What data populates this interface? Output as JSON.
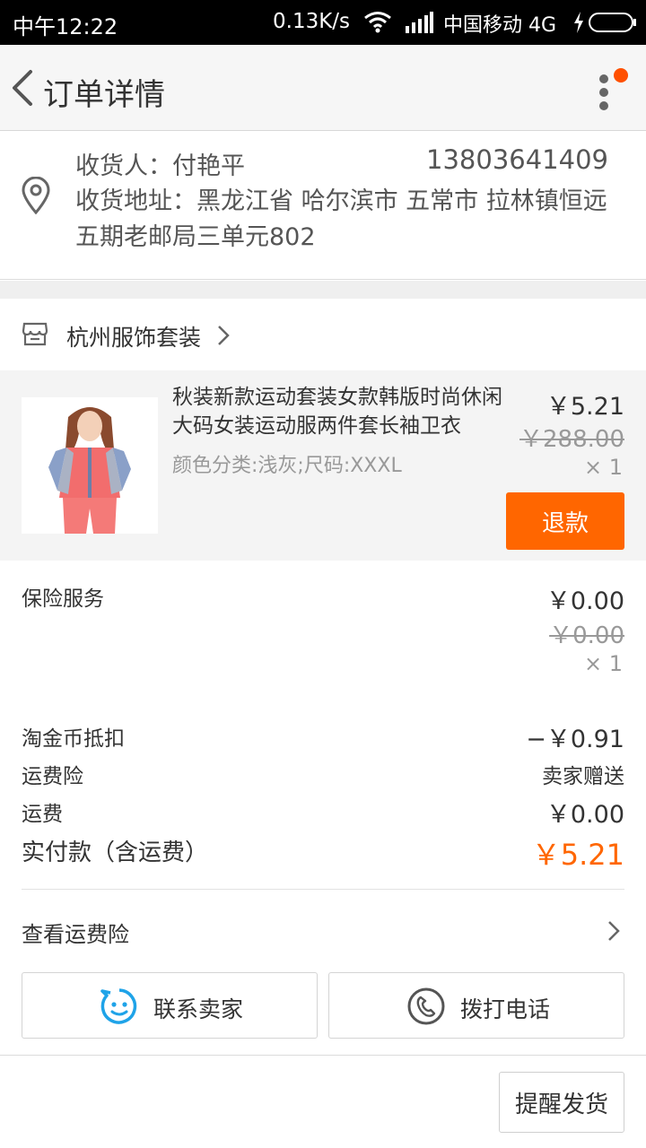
{
  "status_bar": {
    "time": "中午12:22",
    "net_speed": "0.13K/s",
    "carrier": "中国移动 4G",
    "icons": [
      "wifi-icon",
      "signal-icon",
      "charging-icon",
      "battery-icon"
    ]
  },
  "navbar": {
    "title": "订单详情",
    "back_icon": "chevron-left-icon",
    "more_icon": "more-vertical-icon",
    "badge_color": "#ff5000"
  },
  "address": {
    "receiver": "收货人：付艳平",
    "phone": "13803641409",
    "address": "收货地址：黑龙江省 哈尔滨市 五常市 拉林镇恒远五期老邮局三单元802",
    "icon": "location-pin-icon"
  },
  "shop": {
    "name": "杭州服饰套装",
    "icon": "store-icon"
  },
  "product": {
    "title": "秋装新款运动套装女款韩版时尚休闲大码女装运动服两件套长袖卫衣",
    "spec": "颜色分类:浅灰;尺码:XXXL",
    "price": "￥5.21",
    "original_price": "￥288.00",
    "quantity": "× 1",
    "refund_label": "退款"
  },
  "insurance": {
    "label": "保险服务",
    "price": "￥0.00",
    "original_price": "￥0.00",
    "quantity": "× 1"
  },
  "summary": {
    "coin_label": "淘金币抵扣",
    "coin_value": "−￥0.91",
    "freight_ins_label": "运费险",
    "freight_ins_value": "卖家赠送",
    "freight_label": "运费",
    "freight_value": "￥0.00",
    "total_label": "实付款（含运费）",
    "total_value": "￥5.21"
  },
  "links": {
    "view_freight_insurance": "查看运费险"
  },
  "actions": {
    "contact_seller": "联系卖家",
    "call": "拨打电话",
    "remind_ship": "提醒发货"
  },
  "colors": {
    "accent": "#ff6600",
    "contact_icon": "#1fa3e8"
  }
}
